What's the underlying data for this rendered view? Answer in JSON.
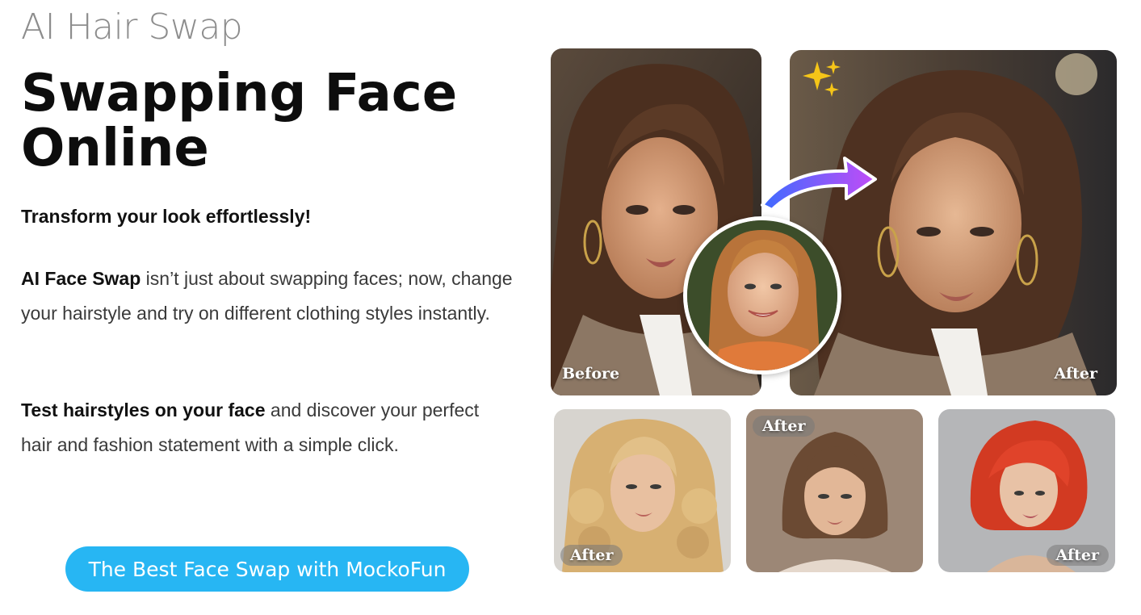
{
  "hero": {
    "eyebrow": "AI Hair Swap",
    "headline": "Swapping Face Online",
    "subhead": "Transform your look effortlessly!",
    "para1_bold": "AI Face Swap",
    "para1_rest": " isn’t just about swapping faces; now, change your hairstyle and try on different clothing styles instantly.",
    "para2_bold": "Test hairstyles on your face",
    "para2_rest": " and discover your perfect hair and fashion statement with a simple click.",
    "cta_label": "The Best Face Swap with MockoFun"
  },
  "collage": {
    "before_label": "Before",
    "after_label": "After",
    "thumb1_label": "After",
    "thumb2_label": "After",
    "thumb3_label": "After"
  },
  "colors": {
    "cta": "#27b6f3",
    "arrow_start": "#3d6bff",
    "arrow_end": "#c24cf6",
    "sparkle": "#f5c518"
  }
}
